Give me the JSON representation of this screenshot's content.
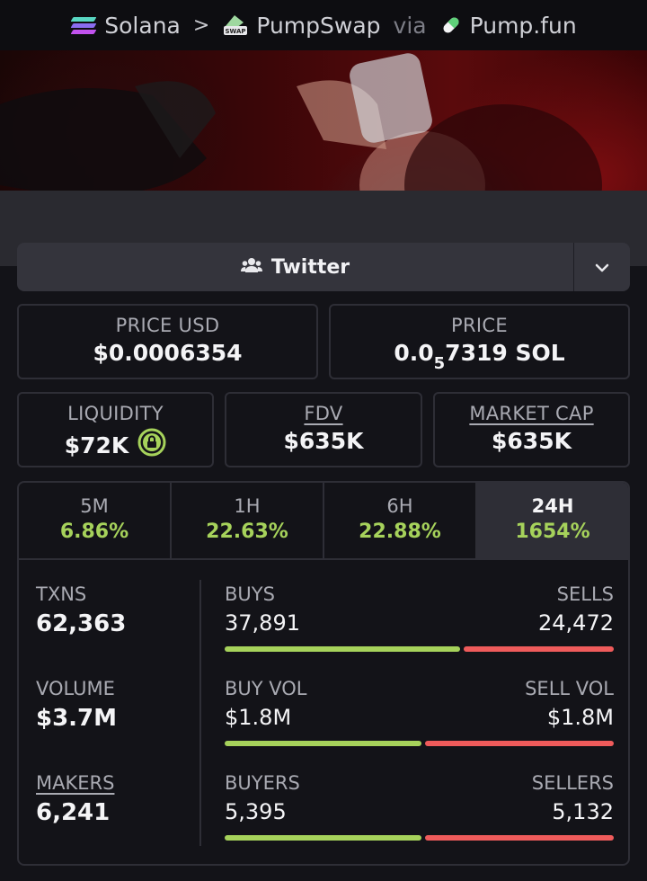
{
  "breadcrumb": {
    "chain": "Solana",
    "dex": "PumpSwap",
    "via": "via",
    "launchpad": "Pump.fun"
  },
  "hero": {
    "icon": "token-banner-image"
  },
  "socials": {
    "twitter_label": "Twitter"
  },
  "price": {
    "usd_label": "PRICE USD",
    "usd_value": "$0.0006354",
    "native_label": "PRICE",
    "native_prefix": "0.0",
    "native_subscript": "5",
    "native_suffix": "7319 SOL"
  },
  "metrics": {
    "liquidity_label": "LIQUIDITY",
    "liquidity_value": "$72K",
    "fdv_label": "FDV",
    "fdv_value": "$635K",
    "mcap_label": "MARKET CAP",
    "mcap_value": "$635K"
  },
  "timeframes": [
    {
      "label": "5M",
      "change": "6.86%"
    },
    {
      "label": "1H",
      "change": "22.63%"
    },
    {
      "label": "6H",
      "change": "22.88%"
    },
    {
      "label": "24H",
      "change": "1654%"
    }
  ],
  "selected_timeframe": "24H",
  "stats": {
    "txns_label": "TXNS",
    "txns_value": "62,363",
    "volume_label": "VOLUME",
    "volume_value": "$3.7M",
    "makers_label": "MAKERS",
    "makers_value": "6,241",
    "buys_label": "BUYS",
    "buys_value": "37,891",
    "sells_label": "SELLS",
    "sells_value": "24,472",
    "buys_ratio": 0.61,
    "buyvol_label": "BUY VOL",
    "buyvol_value": "$1.8M",
    "sellvol_label": "SELL VOL",
    "sellvol_value": "$1.8M",
    "buyvol_ratio": 0.51,
    "buyers_label": "BUYERS",
    "buyers_value": "5,395",
    "sellers_label": "SELLERS",
    "sellers_value": "5,132",
    "buyers_ratio": 0.51
  },
  "colors": {
    "positive": "#a6d25b",
    "negative": "#ef5b5b",
    "background": "#131318",
    "border": "#2e2e36"
  }
}
